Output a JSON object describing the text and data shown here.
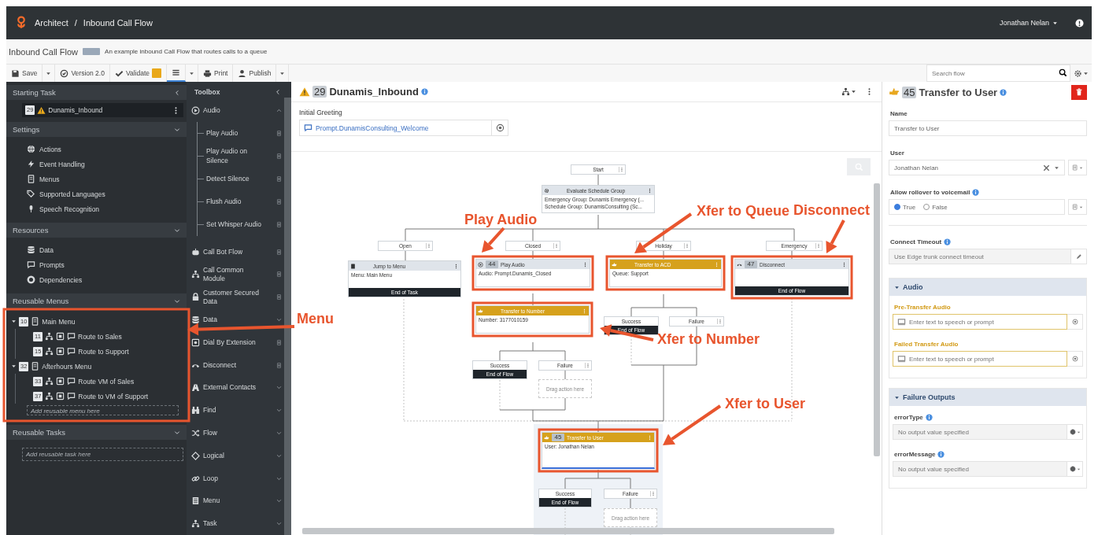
{
  "app_bar": {
    "breadcrumb": [
      "Architect",
      "Inbound Call Flow"
    ],
    "separator": "/",
    "user": "Jonathan Nelan"
  },
  "flow_info": {
    "title": "Inbound Call Flow",
    "description": "An example inbound Call Flow that routes calls to a queue"
  },
  "toolbar": {
    "items": [
      {
        "kind": "button",
        "label": "Save",
        "menu": true
      },
      {
        "kind": "button",
        "label": "Version 2.0",
        "menu": false
      },
      {
        "kind": "validate",
        "label": "Validate",
        "menu": false
      },
      {
        "kind": "view",
        "menu": true,
        "selected": true
      },
      {
        "kind": "button",
        "label": "Print",
        "menu": false
      },
      {
        "kind": "button",
        "label": "Publish",
        "menu": true
      }
    ],
    "search": {
      "placeholder": "Search flow"
    }
  },
  "sidebar": {
    "starting_task": {
      "title": "Starting Task",
      "task": {
        "number": "29",
        "label": "Dunamis_Inbound",
        "warning": true,
        "selected": true
      }
    },
    "sections": [
      {
        "title": "Settings",
        "items": [
          "Actions",
          "Event Handling",
          "Menus",
          "Supported Languages",
          "Speech Recognition"
        ]
      },
      {
        "title": "Resources",
        "items": [
          "Data",
          "Prompts",
          "Dependencies"
        ]
      }
    ],
    "reusable_menus": {
      "title": "Reusable Menus",
      "menus": [
        {
          "number": "10",
          "label": "Main Menu",
          "expanded": true,
          "children": [
            {
              "number": "11",
              "label": "Route to Sales"
            },
            {
              "number": "15",
              "label": "Route to Support"
            }
          ]
        },
        {
          "number": "32",
          "label": "Afterhours Menu",
          "expanded": true,
          "children": [
            {
              "number": "33",
              "label": "Route VM of Sales"
            },
            {
              "number": "37",
              "label": "Route to VM of Support"
            }
          ]
        }
      ],
      "placeholder": "Add reusable menu here"
    },
    "reusable_tasks": {
      "title": "Reusable Tasks",
      "placeholder": "Add reusable task here"
    }
  },
  "toolbox": {
    "title": "Toolbox",
    "items": [
      {
        "kind": "category",
        "label": "Audio",
        "expanded": true,
        "children": [
          "Play Audio",
          "Play Audio on Silence",
          "Detect Silence",
          "Flush Audio",
          "Set Whisper Audio"
        ]
      },
      {
        "kind": "action",
        "label": "Call Bot Flow"
      },
      {
        "kind": "action",
        "label": "Call Common Module"
      },
      {
        "kind": "action",
        "label": "Customer Secured Data"
      },
      {
        "kind": "category",
        "label": "Data",
        "expanded": false
      },
      {
        "kind": "action",
        "label": "Dial By Extension"
      },
      {
        "kind": "action",
        "label": "Disconnect"
      },
      {
        "kind": "category",
        "label": "External Contacts",
        "expanded": false
      },
      {
        "kind": "category",
        "label": "Find",
        "expanded": false
      },
      {
        "kind": "category",
        "label": "Flow",
        "expanded": false
      },
      {
        "kind": "category",
        "label": "Logical",
        "expanded": false
      },
      {
        "kind": "category",
        "label": "Loop",
        "expanded": false
      },
      {
        "kind": "category",
        "label": "Menu",
        "expanded": false
      },
      {
        "kind": "category",
        "label": "Task",
        "expanded": false
      }
    ]
  },
  "canvas": {
    "task": {
      "number": "29",
      "name": "Dunamis_Inbound",
      "warning": true
    },
    "initial_greeting": {
      "label": "Initial Greeting",
      "value": "Prompt.DunamisConsulting_Welcome"
    },
    "nodes": [
      {
        "kind": "start",
        "label": "Start",
        "menu": true
      },
      {
        "kind": "action",
        "title": "Evaluate Schedule Group",
        "details": [
          "Emergency Group: Dunamis Emergency (...",
          "Schedule Group: DunamisConsulting (Sc..."
        ],
        "selected": false
      },
      {
        "kind": "path",
        "label": "Open",
        "menu": true
      },
      {
        "kind": "path",
        "label": "Closed",
        "menu": true
      },
      {
        "kind": "path",
        "label": "Holiday",
        "menu": true
      },
      {
        "kind": "path",
        "label": "Emergency",
        "menu": true
      },
      {
        "kind": "action",
        "title": "Jump to Menu",
        "details": [
          "Menu: Main Menu"
        ],
        "footer": "End of Task",
        "selected": false
      },
      {
        "kind": "action",
        "number": "44",
        "title": "Play Audio",
        "details": [
          "Audio: Prompt.Dunamis_Closed"
        ],
        "selected": false
      },
      {
        "kind": "transfer",
        "title": "Transfer to ACD",
        "details": [
          "Queue: Support"
        ],
        "selected": false
      },
      {
        "kind": "action",
        "number": "47",
        "title": "Disconnect",
        "footer": "End of Flow",
        "selected": false
      },
      {
        "kind": "transfer",
        "title": "Transfer to Number",
        "details": [
          "Number: 3177010159"
        ],
        "selected": false
      },
      {
        "kind": "path",
        "label": "Success",
        "menu": false,
        "footer": "End of Flow"
      },
      {
        "kind": "path",
        "label": "Failure",
        "menu": true
      },
      {
        "kind": "path",
        "label": "Success",
        "menu": false,
        "footer": "End of Flow"
      },
      {
        "kind": "path",
        "label": "Failure",
        "menu": true
      },
      {
        "kind": "drop",
        "label": "Drag action here"
      },
      {
        "kind": "transfer",
        "number": "45",
        "title": "Transfer to User",
        "details": [
          "User: Jonathan Nelan"
        ],
        "selected": true
      },
      {
        "kind": "path",
        "label": "Success",
        "menu": false,
        "footer": "End of Flow"
      },
      {
        "kind": "path",
        "label": "Failure",
        "menu": true
      },
      {
        "kind": "drop",
        "label": "Drag action here"
      }
    ]
  },
  "properties": {
    "number": "45",
    "title": "Transfer to User",
    "fields": [
      {
        "kind": "text",
        "label": "Name",
        "value": "Transfer to User"
      },
      {
        "kind": "select",
        "label": "User",
        "value": "Jonathan Nelan"
      },
      {
        "kind": "radio",
        "label": "Allow rollover to voicemail",
        "options": [
          {
            "label": "True",
            "selected": true
          },
          {
            "label": "False",
            "selected": false
          }
        ]
      },
      {
        "kind": "timeout",
        "label": "Connect Timeout",
        "placeholder": "Use Edge trunk connect timeout"
      }
    ],
    "sections": [
      {
        "title": "Audio",
        "expanded": true,
        "fields": [
          {
            "kind": "prompt",
            "label": "Pre-Transfer Audio",
            "placeholder": "Enter text to speech or prompt"
          },
          {
            "kind": "prompt",
            "label": "Failed Transfer Audio",
            "placeholder": "Enter text to speech or prompt"
          }
        ]
      },
      {
        "title": "Failure Outputs",
        "expanded": true,
        "fields": [
          {
            "kind": "output",
            "label": "errorType",
            "placeholder": "No output value specified"
          },
          {
            "kind": "output",
            "label": "errorMessage",
            "placeholder": "No output value specified"
          }
        ]
      }
    ]
  },
  "annotations": [
    {
      "label": "Menu"
    },
    {
      "label": "Play Audio"
    },
    {
      "label": "Xfer to Queue"
    },
    {
      "label": "Disconnect"
    },
    {
      "label": "Xfer to Number"
    },
    {
      "label": "Xfer to User"
    }
  ]
}
